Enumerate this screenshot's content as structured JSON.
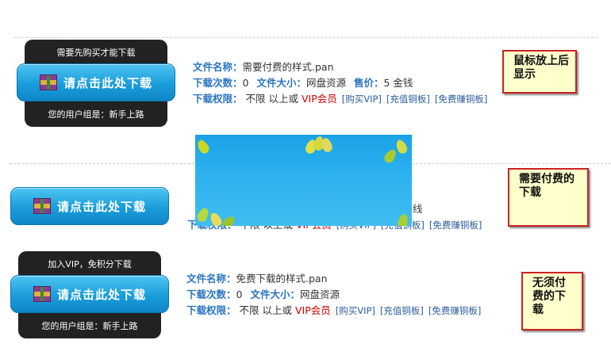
{
  "blocks": [
    {
      "top_text": "需要先购买才能下载",
      "button_label": "请点击此处下载",
      "bottom_text": "您的用户组是：新手上路",
      "fields": {
        "filename_label": "文件名称：",
        "filename_value": "需要付费的样式.pan",
        "downloads_label": "下载次数：",
        "downloads_value": "0",
        "size_label": "文件大小：",
        "size_value": "网盘资源",
        "price_label": "售价：",
        "price_value": "5 金钱",
        "perm_label": "下载权限：",
        "perm_value": "不限  以上或",
        "vip": "VIP会员",
        "links": [
          "[购买VIP]",
          "[充值铜板]",
          "[免费赚铜板]"
        ]
      },
      "note": "鼠标放上后显示"
    },
    {
      "button_label": "请点击此处下载",
      "fields": {
        "partial_text": "线",
        "perm_label": "下载权限：",
        "perm_value": "不限  以上或",
        "vip": "VIP会员",
        "links": [
          "[购买VIP]",
          "[充值铜板]",
          "[免费赚铜板]"
        ]
      },
      "note": "需要付费的下载"
    },
    {
      "top_text": "加入VIP，免积分下载",
      "button_label": "请点击此处下载",
      "bottom_text": "您的用户组是：新手上路",
      "fields": {
        "filename_label": "文件名称：",
        "filename_value": "免费下载的样式.pan",
        "downloads_label": "下载次数：",
        "downloads_value": "0",
        "size_label": "文件大小：",
        "size_value": "网盘资源",
        "perm_label": "下载权限：",
        "perm_value": "不限  以上或",
        "vip": "VIP会员",
        "links": [
          "[购买VIP]",
          "[充值铜板]",
          "[免费赚铜板]"
        ]
      },
      "note": "无须付费的下载"
    }
  ],
  "icons": {
    "download_icon": "winrar-archive-icon",
    "overlay_decoration": "leaf-icon"
  },
  "colors": {
    "label_blue": "#2a74c0",
    "vip_red": "#cc0000",
    "button_blue": "#1a9ddb",
    "note_border": "#cc2222",
    "note_fill": "#ffffcc"
  }
}
